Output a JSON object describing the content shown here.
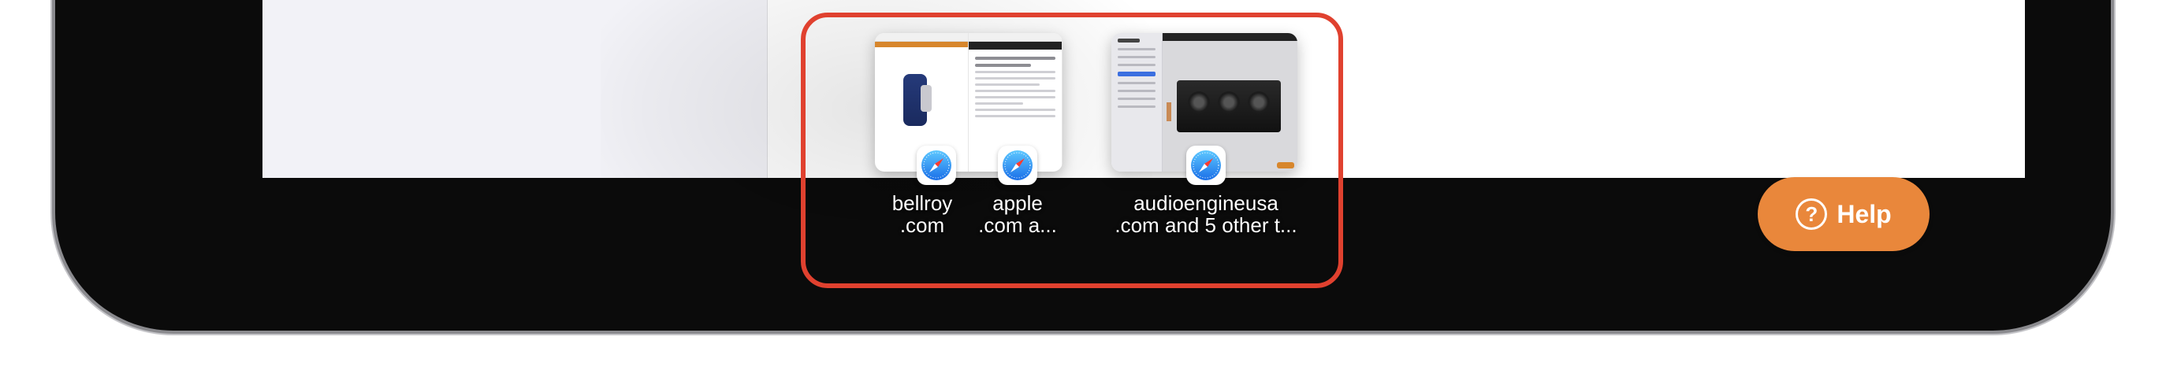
{
  "switcher": {
    "cards": [
      {
        "label_line1": "bellroy",
        "label_line2": ".com",
        "app_icon": "safari-icon"
      },
      {
        "label_line1": "apple",
        "label_line2": ".com a...",
        "app_icon": "safari-icon"
      },
      {
        "label_line1": "audioengineusa",
        "label_line2": ".com and 5 other t...",
        "app_icon": "safari-icon"
      }
    ],
    "highlight_color": "#e0412f"
  },
  "help": {
    "label": "Help",
    "icon": "question-circle-icon",
    "color": "#e9873b"
  }
}
